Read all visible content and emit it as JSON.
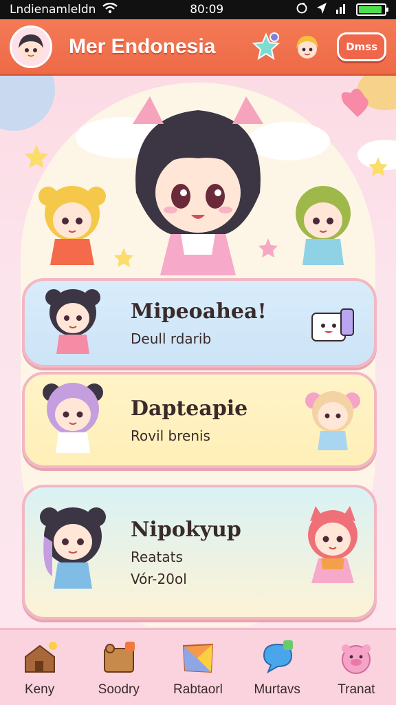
{
  "status_bar": {
    "carrier": "Lndienamleldn",
    "time": "80:09"
  },
  "header": {
    "title": "Mer Endonesia",
    "button_label": "Dmss"
  },
  "cards": [
    {
      "title": "Mipeoahea!",
      "subtitle": "Deull rdarib",
      "subtitle2": ""
    },
    {
      "title": "Dapteapie",
      "subtitle": "Rovil brenis",
      "subtitle2": ""
    },
    {
      "title": "Nipokyup",
      "subtitle": "Reatats",
      "subtitle2": "Vór-20ol"
    }
  ],
  "nav": [
    {
      "label": "Keny",
      "icon": "house-icon"
    },
    {
      "label": "Soodry",
      "icon": "bear-box-icon"
    },
    {
      "label": "Rabtaorl",
      "icon": "origami-icon"
    },
    {
      "label": "Murtavs",
      "icon": "chat-bubble-icon"
    },
    {
      "label": "Tranat",
      "icon": "pig-icon"
    }
  ],
  "colors": {
    "header": "#ee6a47",
    "background": "#fce4ec",
    "card_border": "#f2b7c2"
  }
}
